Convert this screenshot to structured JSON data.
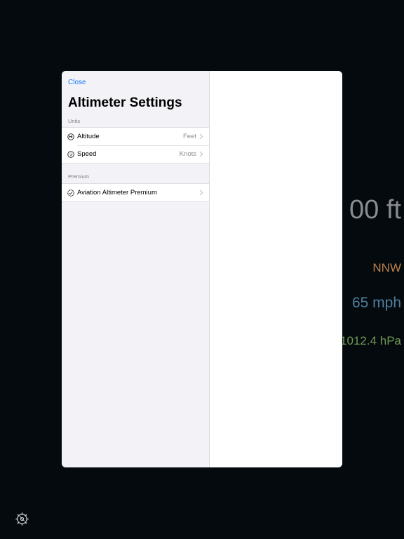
{
  "background": {
    "altitude": "00 ft",
    "direction": "NNW",
    "speed": "65 mph",
    "pressure": "1012.4 hPa",
    "colors": {
      "background": "#050a0e",
      "altitude": "#8a8d90",
      "direction": "#b9804b",
      "speed": "#4e7f9d",
      "pressure": "#6f9a55"
    }
  },
  "settings": {
    "close_label": "Close",
    "title": "Altimeter Settings",
    "sections": {
      "units": {
        "header": "Units",
        "rows": [
          {
            "icon": "altitude-gauge-icon",
            "label": "Altitude",
            "value": "Feet"
          },
          {
            "icon": "speedometer-icon",
            "label": "Speed",
            "value": "Knots"
          }
        ]
      },
      "premium": {
        "header": "Premium",
        "rows": [
          {
            "icon": "checkmark-seal-icon",
            "label": "Aviation Altimeter Premium"
          }
        ]
      }
    },
    "accent_color": "#1a7cf2"
  }
}
